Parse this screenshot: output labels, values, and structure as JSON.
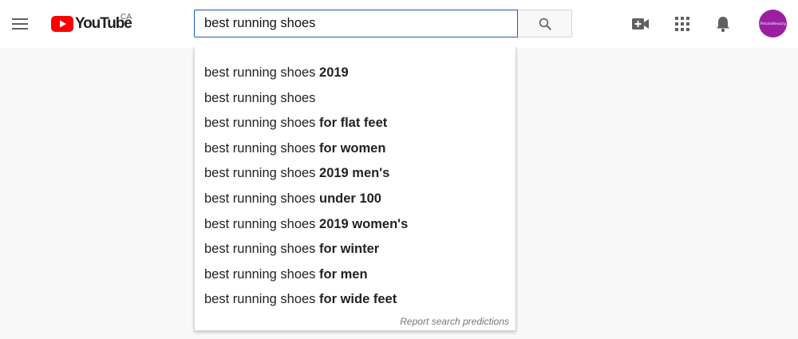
{
  "header": {
    "menu_icon": "hamburger-menu-icon",
    "logo": {
      "brand": "YouTube",
      "region": "CA",
      "brand_color": "#ff0000"
    },
    "search": {
      "value": "best running shoes",
      "button_icon": "search-icon"
    },
    "actions": [
      {
        "icon": "create-video-icon"
      },
      {
        "icon": "apps-grid-icon"
      },
      {
        "icon": "notifications-bell-icon"
      }
    ],
    "avatar": {
      "text": "PetalsBeauty",
      "color": "#9c1fa2"
    }
  },
  "suggestions": {
    "typed": "best running shoes",
    "items": [
      {
        "completion": " 2019"
      },
      {
        "completion": ""
      },
      {
        "completion": " for flat feet"
      },
      {
        "completion": " for women"
      },
      {
        "completion": " 2019 men's"
      },
      {
        "completion": " under 100"
      },
      {
        "completion": " 2019 women's"
      },
      {
        "completion": " for winter"
      },
      {
        "completion": " for men"
      },
      {
        "completion": " for wide feet"
      }
    ],
    "report_label": "Report search predictions"
  }
}
